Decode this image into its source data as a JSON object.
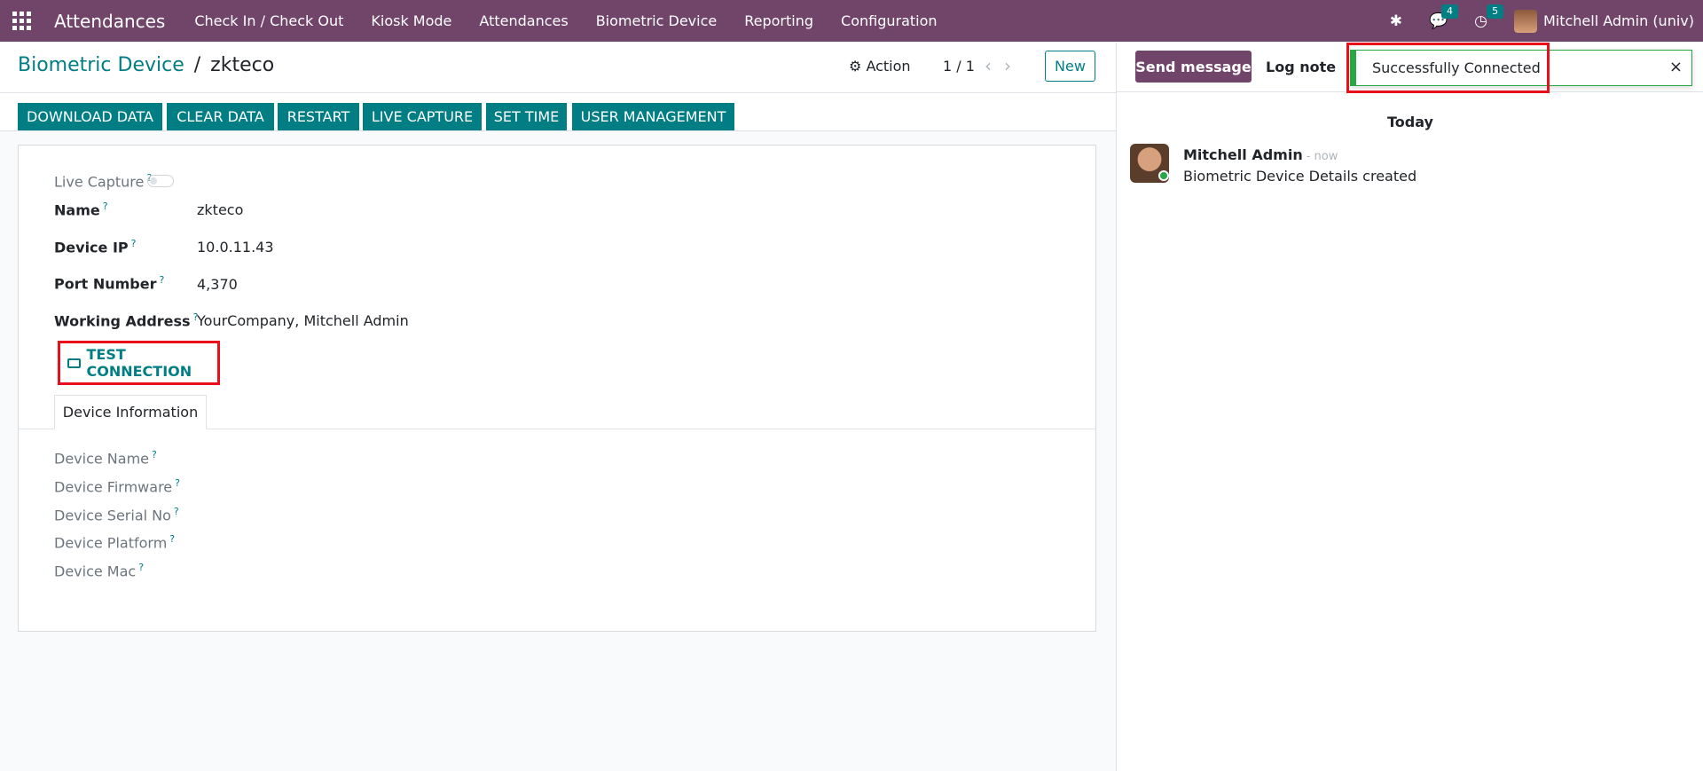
{
  "navbar": {
    "brand": "Attendances",
    "menu": [
      "Check In / Check Out",
      "Kiosk Mode",
      "Attendances",
      "Biometric Device",
      "Reporting",
      "Configuration"
    ],
    "messages_count": "4",
    "activities_count": "5",
    "user": "Mitchell Admin (univ)"
  },
  "breadcrumb": {
    "parent": "Biometric Device",
    "separator": "/",
    "current": "zkteco"
  },
  "control_panel": {
    "action": "Action",
    "pager": "1 / 1",
    "new": "New"
  },
  "header_buttons": [
    "DOWNLOAD DATA",
    "CLEAR DATA",
    "RESTART",
    "LIVE CAPTURE",
    "SET TIME",
    "USER MANAGEMENT"
  ],
  "form": {
    "live_capture_label": "Live Capture",
    "name_label": "Name",
    "name_value": "zkteco",
    "ip_label": "Device IP",
    "ip_value": "10.0.11.43",
    "port_label": "Port Number",
    "port_value": "4,370",
    "address_label": "Working Address",
    "address_value": "YourCompany, Mitchell Admin",
    "test_connection": "TEST CONNECTION",
    "tab": "Device Information",
    "info_fields": [
      "Device Name",
      "Device Firmware",
      "Device Serial No",
      "Device Platform",
      "Device Mac"
    ]
  },
  "chatter": {
    "send_message": "Send message",
    "log_note": "Log note",
    "today": "Today",
    "author": "Mitchell Admin",
    "when": "- now",
    "body": "Biometric Device Details created"
  },
  "notification": {
    "text": "Successfully Connected",
    "close": "×"
  },
  "colors": {
    "navbar": "#71446a",
    "primary": "#017e84",
    "highlight": "#e8101a",
    "success": "#28a745"
  }
}
